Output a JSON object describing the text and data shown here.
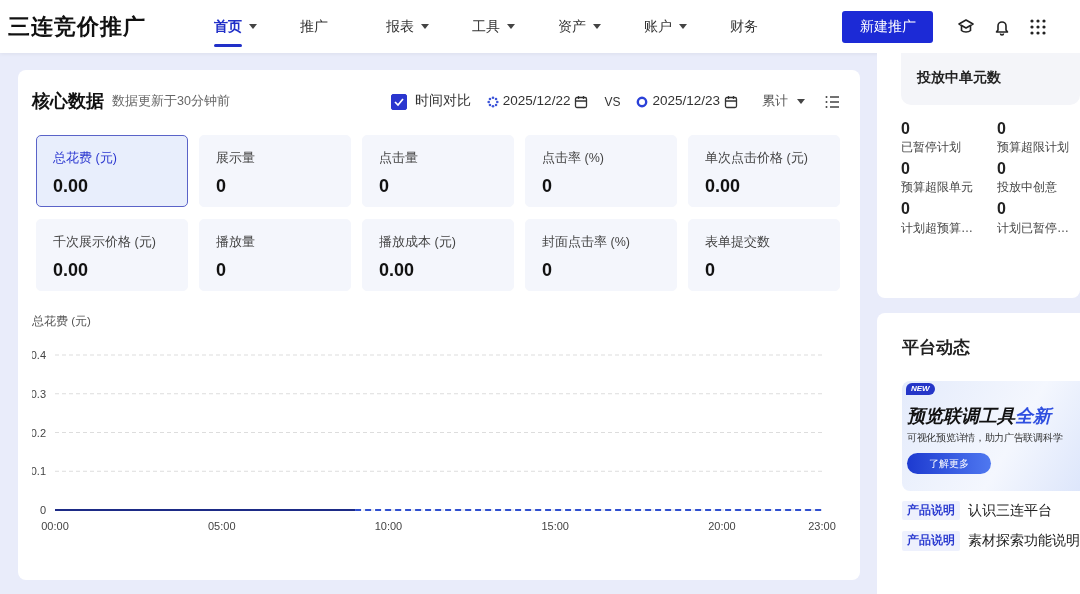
{
  "brand": "三连竞价推广",
  "nav": [
    {
      "label": "首页",
      "selected": true,
      "dropdown": true
    },
    {
      "label": "推广",
      "selected": false,
      "dropdown": false
    },
    {
      "label": "报表",
      "selected": false,
      "dropdown": true
    },
    {
      "label": "工具",
      "selected": false,
      "dropdown": true
    },
    {
      "label": "资产",
      "selected": false,
      "dropdown": true
    },
    {
      "label": "账户",
      "selected": false,
      "dropdown": true
    },
    {
      "label": "财务",
      "selected": false,
      "dropdown": false
    }
  ],
  "new_button": "新建推广",
  "core": {
    "title": "核心数据",
    "subtitle": "数据更新于30分钟前",
    "compare": {
      "label": "时间对比",
      "checked": true
    },
    "vs": "VS",
    "mode": "累计",
    "metrics": [
      {
        "label": "总花费 (元)",
        "value": "0.00",
        "selected": true
      },
      {
        "label": "展示量",
        "value": "0",
        "selected": false
      },
      {
        "label": "点击量",
        "value": "0",
        "selected": false
      },
      {
        "label": "点击率 (%)",
        "value": "0",
        "selected": false
      },
      {
        "label": "单次点击价格 (元)",
        "value": "0.00",
        "selected": false
      },
      {
        "label": "千次展示价格 (元)",
        "value": "0.00",
        "selected": false
      },
      {
        "label": "播放量",
        "value": "0",
        "selected": false
      },
      {
        "label": "播放成本 (元)",
        "value": "0.00",
        "selected": false
      },
      {
        "label": "封面点击率 (%)",
        "value": "0",
        "selected": false
      },
      {
        "label": "表单提交数",
        "value": "0",
        "selected": false
      }
    ],
    "chart_data": {
      "type": "line",
      "ylabel": "总花费 (元)",
      "grid": true,
      "x": [
        0,
        1,
        2,
        3,
        4,
        5,
        6,
        7,
        8,
        9,
        10,
        11,
        12,
        13,
        14,
        15,
        16,
        17,
        18,
        19,
        20,
        21,
        22,
        23
      ],
      "xlim": [
        0,
        23
      ],
      "ylim": [
        0,
        0.4
      ],
      "yticks": [
        0,
        0.1,
        0.2,
        0.3,
        0.4
      ],
      "xticks": [
        {
          "value": 0,
          "label": "00:00"
        },
        {
          "value": 5,
          "label": "05:00"
        },
        {
          "value": 10,
          "label": "10:00"
        },
        {
          "value": 15,
          "label": "15:00"
        },
        {
          "value": 20,
          "label": "20:00"
        },
        {
          "value": 23,
          "label": "23:00"
        }
      ],
      "series": [
        {
          "name": "2025/12/23",
          "color": "#1d2b86",
          "line_style": "solid",
          "values": [
            0,
            0,
            0,
            0,
            0,
            0,
            0,
            0,
            0,
            0,
            null,
            null,
            null,
            null,
            null,
            null,
            null,
            null,
            null,
            null,
            null,
            null,
            null,
            null
          ]
        },
        {
          "name": "2025/12/22",
          "color": "#2f4fd0",
          "line_style": "dashed",
          "values": [
            null,
            null,
            null,
            null,
            null,
            null,
            null,
            null,
            null,
            0,
            0,
            0,
            0,
            0,
            0,
            0,
            0,
            0,
            0,
            0,
            0,
            0,
            0,
            0
          ]
        }
      ]
    }
  },
  "units": {
    "title": "投放中单元数",
    "stats": [
      {
        "value": "0",
        "label": "已暂停计划"
      },
      {
        "value": "0",
        "label": "预算超限计划"
      },
      {
        "value": "0",
        "label": "预算超限单元"
      },
      {
        "value": "0",
        "label": "投放中创意"
      },
      {
        "value": "0",
        "label": "计划超预算…"
      },
      {
        "value": "0",
        "label": "计划已暂停…"
      }
    ]
  },
  "news": {
    "title": "平台动态",
    "banner": {
      "badge": "NEW",
      "title": "预览联调工具",
      "title_accent": "全新",
      "text": "可视化预览详情，助力广告联调科学",
      "button": "了解更多"
    },
    "items": [
      {
        "tag": "产品说明",
        "text": "认识三连平台"
      },
      {
        "tag": "产品说明",
        "text": "素材探索功能说明"
      }
    ]
  }
}
